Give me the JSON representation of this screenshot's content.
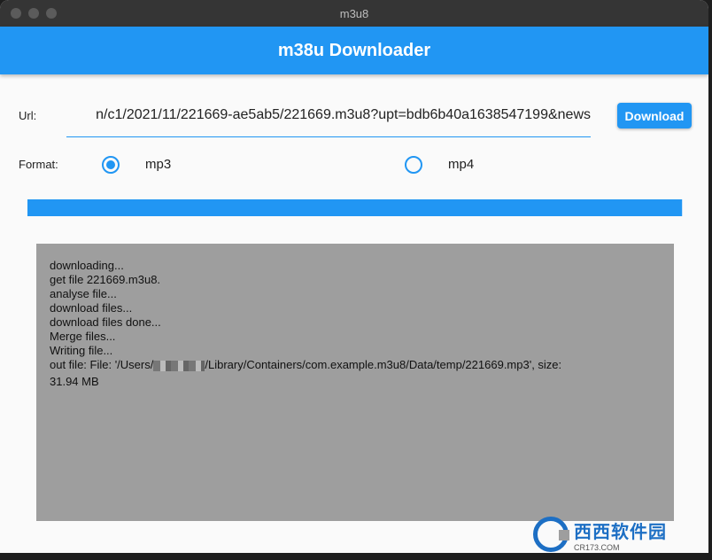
{
  "window": {
    "title": "m3u8"
  },
  "appbar": {
    "title": "m38u Downloader"
  },
  "url": {
    "label": "Url:",
    "value": "n/c1/2021/11/221669-ae5ab5/221669.m3u8?upt=bdb6b40a1638547199&news"
  },
  "download_button": {
    "label": "Download"
  },
  "format": {
    "label": "Format:",
    "options": [
      {
        "label": "mp3",
        "selected": true
      },
      {
        "label": "mp4",
        "selected": false
      }
    ]
  },
  "progress": {
    "value": 0.998
  },
  "log": {
    "lines": [
      "downloading...",
      "get file 221669.m3u8.",
      "analyse file...",
      "download files...",
      "download files done...",
      "Merge files...",
      "Writing file..."
    ],
    "out_prefix": "out file: File: '/Users/",
    "out_suffix": "/Library/Containers/com.example.m3u8/Data/temp/221669.mp3',    size:",
    "size_line": "31.94 MB"
  },
  "watermark": {
    "main": "西西软件园",
    "sub": "CR173.COM"
  },
  "colors": {
    "accent": "#2196f3",
    "log_bg": "#9e9e9e",
    "titlebar": "#353535"
  }
}
